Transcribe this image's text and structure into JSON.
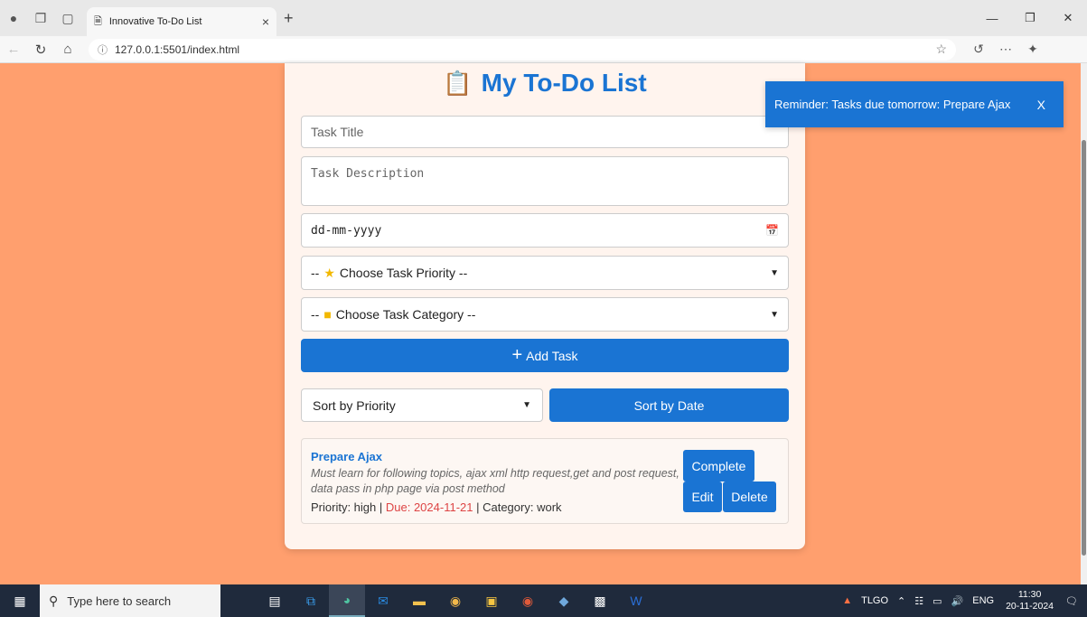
{
  "browser": {
    "tab_title": "Innovative To-Do List",
    "tab_close": "×",
    "new_tab": "+",
    "url": "127.0.0.1:5501/index.html"
  },
  "app": {
    "heading": "My To-Do List",
    "task_title_placeholder": "Task Title",
    "task_description_placeholder": "Task Description",
    "date_placeholder": "dd-mm-yyyy",
    "priority_prefix": "--",
    "priority_label": "Choose Task Priority --",
    "category_prefix": "--",
    "category_label": "Choose Task Category --",
    "add_button": "Add Task",
    "sort_select_value": "Sort by Priority",
    "sort_date_button": "Sort by Date"
  },
  "tasks": [
    {
      "title": "Prepare Ajax",
      "description": "Must learn for following topics, ajax xml http request,get and post request, data pass in php page via post method",
      "priority_text": "Priority: high |",
      "due_text": "Due: 2024-11-21",
      "category_text": "| Category: work",
      "complete_label": "Complete",
      "edit_label": "Edit",
      "delete_label": "Delete"
    }
  ],
  "toast": {
    "message": "Reminder: Tasks due tomorrow: Prepare Ajax",
    "close": "X"
  },
  "taskbar": {
    "search_placeholder": "Type here to search",
    "tray_app": "TLGO",
    "language": "ENG",
    "time": "11:30",
    "date": "20-11-2024"
  },
  "colors": {
    "page_background": "#ff9f6e",
    "accent": "#1a74d3",
    "due_date": "#dd4444"
  }
}
